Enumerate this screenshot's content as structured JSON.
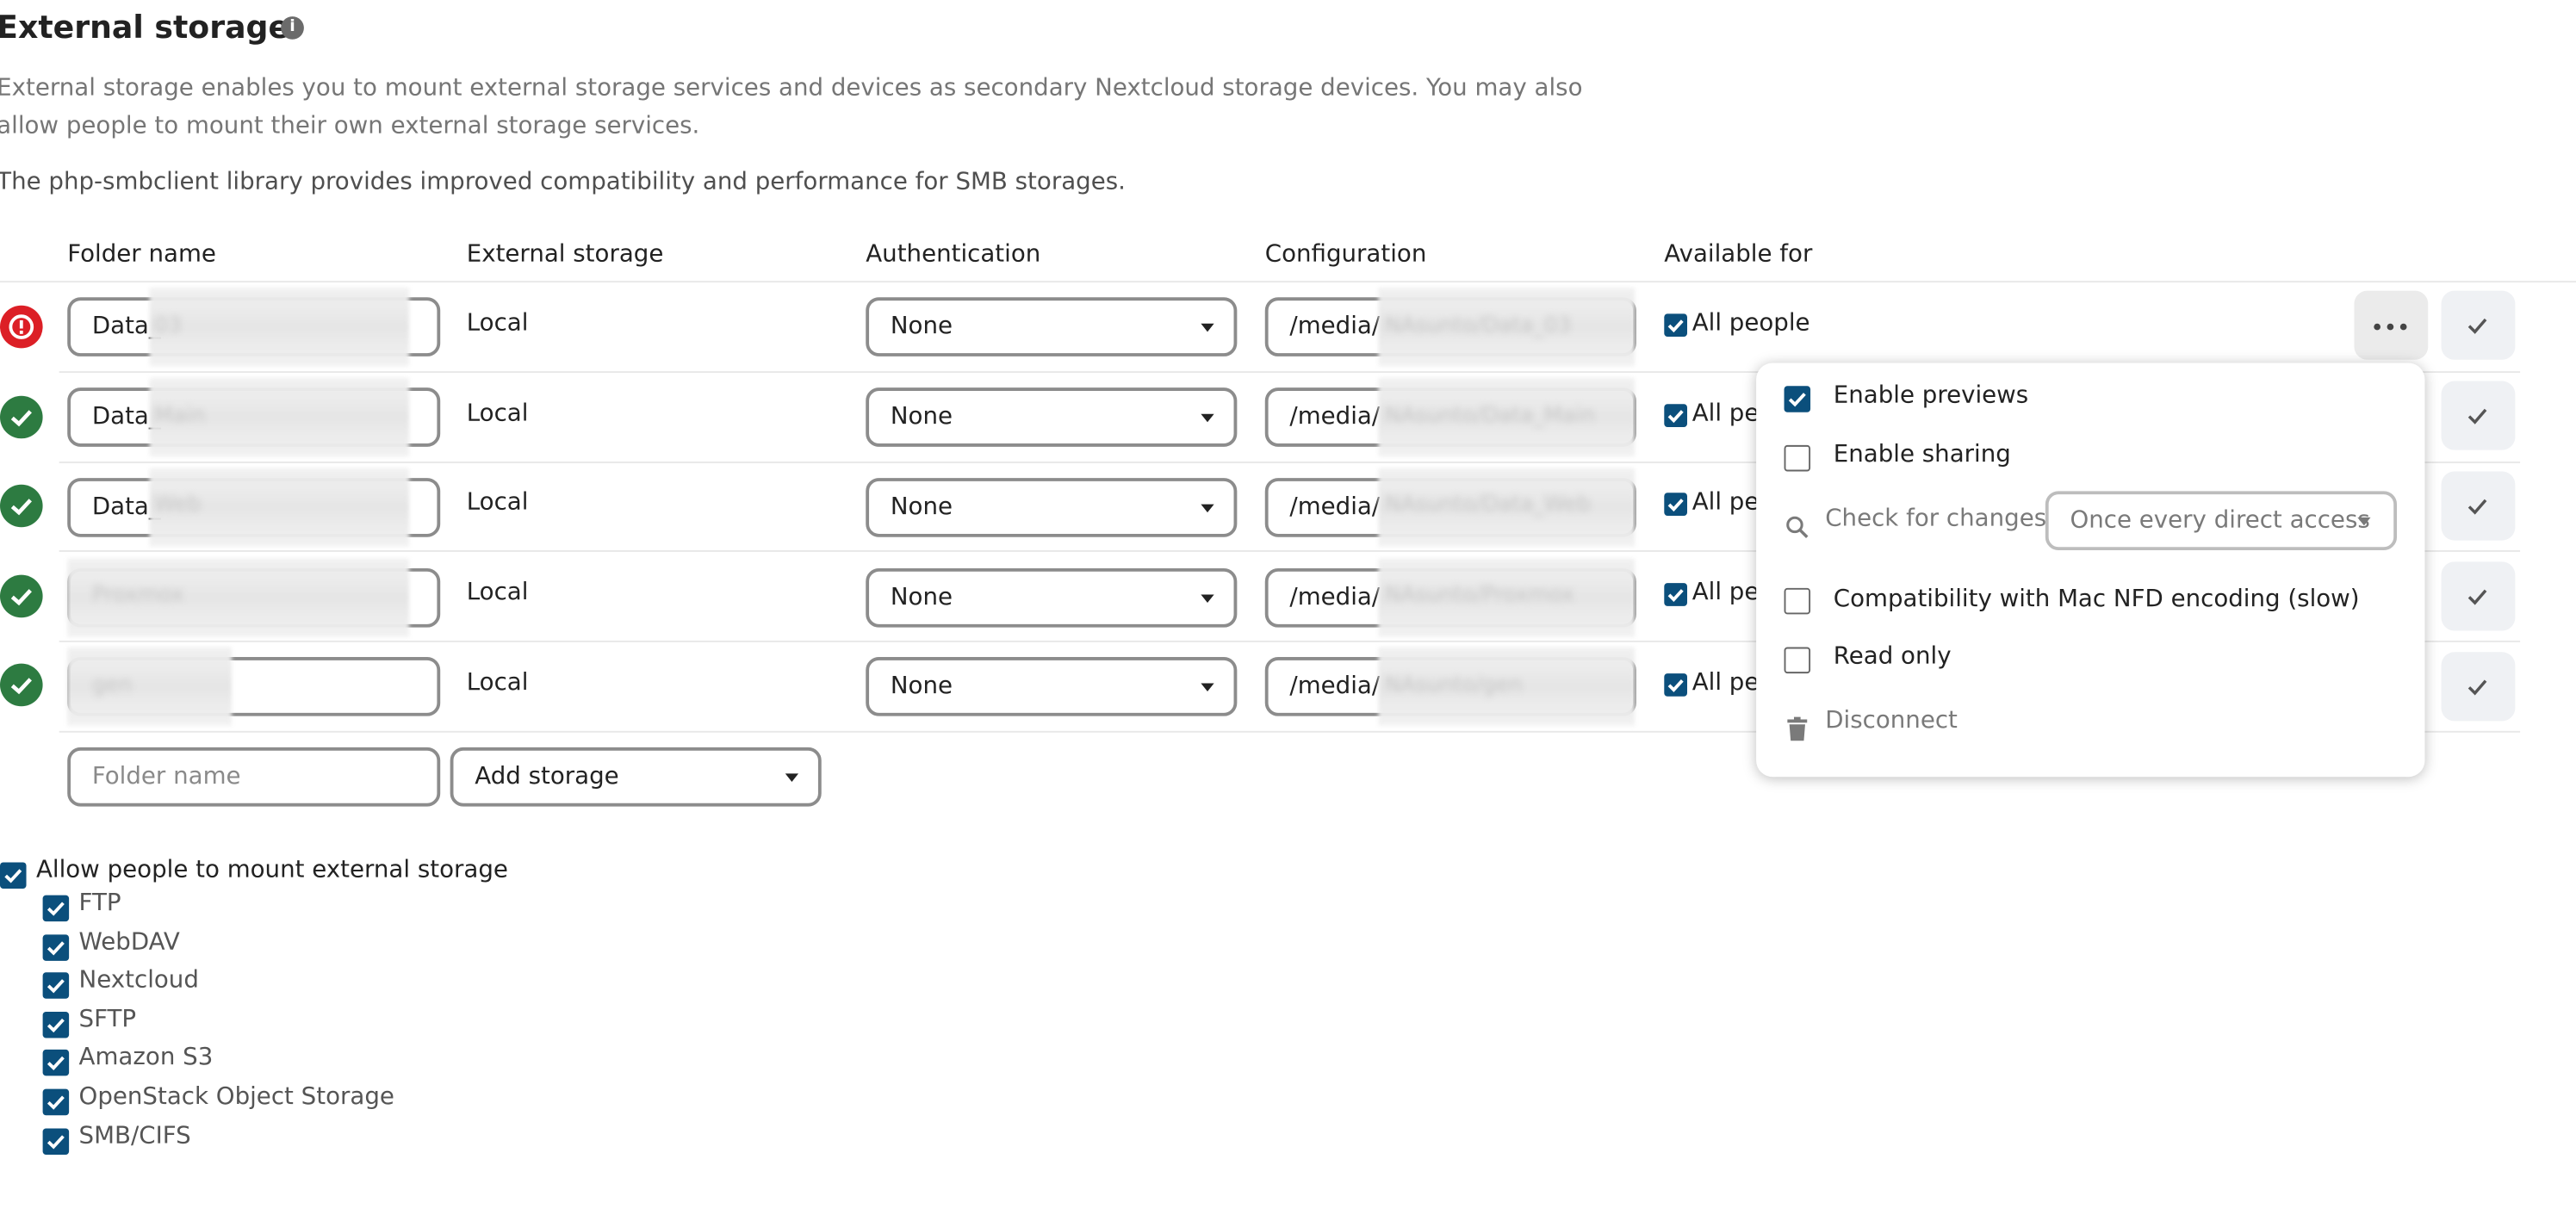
{
  "page": {
    "title": "External storage",
    "description_line1": "External storage enables you to mount external storage services and devices as secondary Nextcloud storage devices. You may also",
    "description_line2": "allow people to mount their own external storage services.",
    "smb_note": "The php-smbclient library provides improved compatibility and performance for SMB storages."
  },
  "table": {
    "headers": {
      "folder_name": "Folder name",
      "external_storage": "External storage",
      "authentication": "Authentication",
      "configuration": "Configuration",
      "available_for": "Available for"
    },
    "rows": [
      {
        "status": "error",
        "folder_name": "Data_",
        "folder_hidden": "03",
        "backend": "Local",
        "auth": "None",
        "config": "/media/",
        "config_hidden": "NAsunto/Data_03",
        "available": "All people"
      },
      {
        "status": "ok",
        "folder_name": "Data_",
        "folder_hidden": "Main",
        "backend": "Local",
        "auth": "None",
        "config": "/media/",
        "config_hidden": "NAsunto/Data_Main",
        "available": "All pe"
      },
      {
        "status": "ok",
        "folder_name": "Data_",
        "folder_hidden": "Web",
        "backend": "Local",
        "auth": "None",
        "config": "/media/",
        "config_hidden": "NAsunto/Data_Web",
        "available": "All pe"
      },
      {
        "status": "ok",
        "folder_name": "",
        "folder_hidden": "Proxmox",
        "backend": "Local",
        "auth": "None",
        "config": "/media/",
        "config_hidden": "NAsunto/Proxmox",
        "available": "All pe"
      },
      {
        "status": "ok",
        "folder_name": "",
        "folder_hidden": "gen",
        "backend": "Local",
        "auth": "None",
        "config": "/media/",
        "config_hidden": "NAsunto/gen",
        "available": "All pe"
      }
    ],
    "new_row": {
      "folder_placeholder": "Folder name",
      "add_storage_label": "Add storage"
    }
  },
  "actions_menu": {
    "enable_previews": {
      "label": "Enable previews",
      "checked": true
    },
    "enable_sharing": {
      "label": "Enable sharing",
      "checked": false
    },
    "check_for_changes_label": "Check for changes",
    "check_for_changes_value": "Once every direct access",
    "mac_nfd": {
      "label": "Compatibility with Mac NFD encoding (slow)",
      "checked": false
    },
    "read_only": {
      "label": "Read only",
      "checked": false
    },
    "disconnect_label": "Disconnect"
  },
  "user_mounting": {
    "allow_label": "Allow people to mount external storage",
    "allow_checked": true,
    "backends": [
      "FTP",
      "WebDAV",
      "Nextcloud",
      "SFTP",
      "Amazon S3",
      "OpenStack Object Storage",
      "SMB/CIFS"
    ]
  },
  "colors": {
    "checkbox_accent": "#0b4f7c",
    "status_ok": "#2d7b41",
    "status_error": "#dc1f26"
  },
  "icons": {
    "info": "info-icon",
    "status_ok": "check-circle-icon",
    "status_error": "alert-circle-icon",
    "more": "more-horizontal-icon",
    "save": "check-icon",
    "search": "search-icon",
    "trash": "trash-icon"
  }
}
